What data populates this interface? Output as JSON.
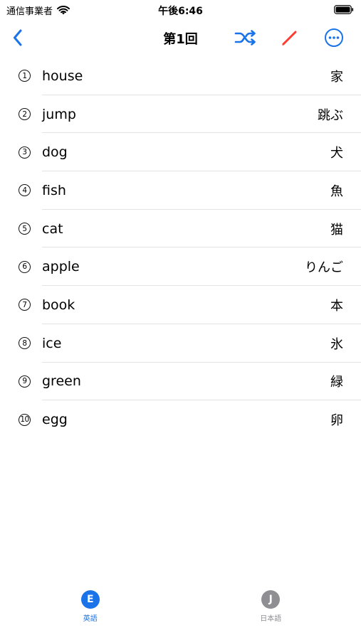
{
  "status": {
    "carrier": "通信事業者",
    "time": "午後6:46"
  },
  "nav": {
    "title": "第1回",
    "icons": [
      "chevron-left-icon",
      "shuffle-icon",
      "pencil-icon",
      "ellipsis-circle-icon"
    ]
  },
  "words": [
    {
      "num": "1",
      "en": "house",
      "jp": "家"
    },
    {
      "num": "2",
      "en": "jump",
      "jp": "跳ぶ"
    },
    {
      "num": "3",
      "en": "dog",
      "jp": "犬"
    },
    {
      "num": "4",
      "en": "fish",
      "jp": "魚"
    },
    {
      "num": "5",
      "en": "cat",
      "jp": "猫"
    },
    {
      "num": "6",
      "en": "apple",
      "jp": "りんご"
    },
    {
      "num": "7",
      "en": "book",
      "jp": "本"
    },
    {
      "num": "8",
      "en": "ice",
      "jp": "氷"
    },
    {
      "num": "9",
      "en": "green",
      "jp": "緑"
    },
    {
      "num": "10",
      "en": "egg",
      "jp": "卵"
    }
  ],
  "tabs": [
    {
      "letter": "E",
      "label": "英語",
      "active": true
    },
    {
      "letter": "J",
      "label": "日本語",
      "active": false
    }
  ],
  "colors": {
    "accent": "#1a73e8",
    "pencil": "#ff3b30",
    "inactive": "#8e8e93",
    "separator": "#e3e3e6"
  }
}
